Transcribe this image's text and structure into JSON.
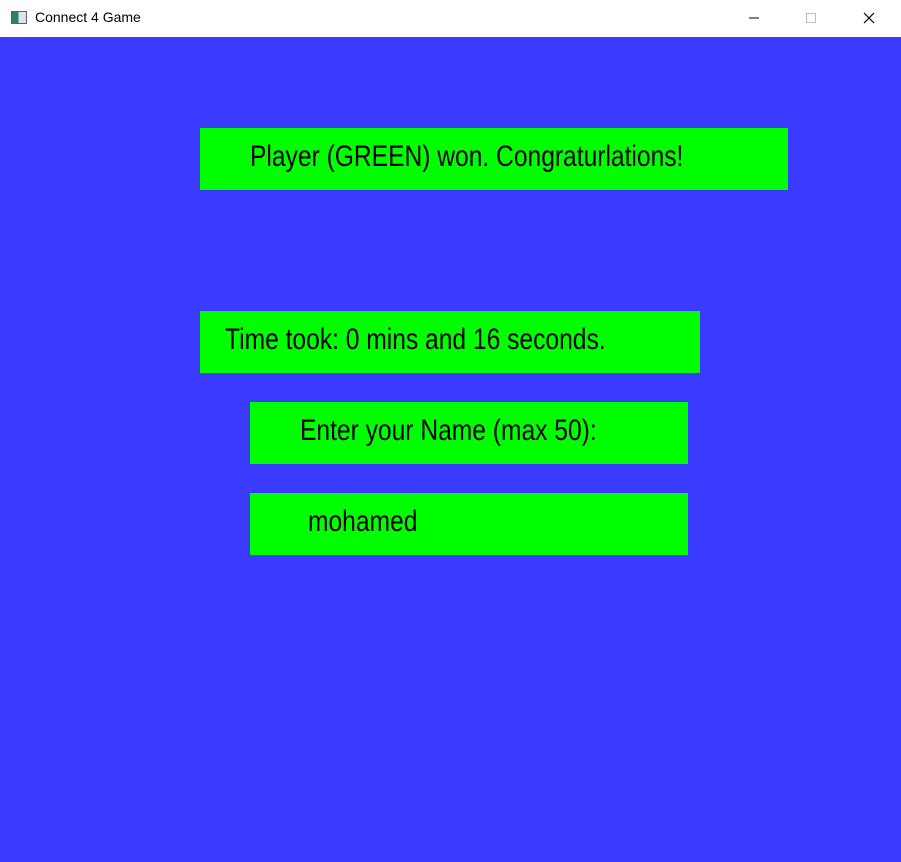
{
  "window": {
    "title": "Connect 4 Game",
    "icon": "app-window-icon",
    "controls": {
      "minimize_icon": "minimize-icon",
      "maximize_icon": "maximize-icon",
      "close_icon": "close-icon"
    }
  },
  "colors": {
    "background": "#3b3bff",
    "panel": "#00ff00",
    "text": "#000000"
  },
  "game_over": {
    "winner_message": "Player (GREEN) won. Congraturlations!",
    "time_message": "Time took: 0 mins and 16 seconds.",
    "name_prompt": "Enter your Name (max 50):",
    "name_value": "mohamed"
  }
}
